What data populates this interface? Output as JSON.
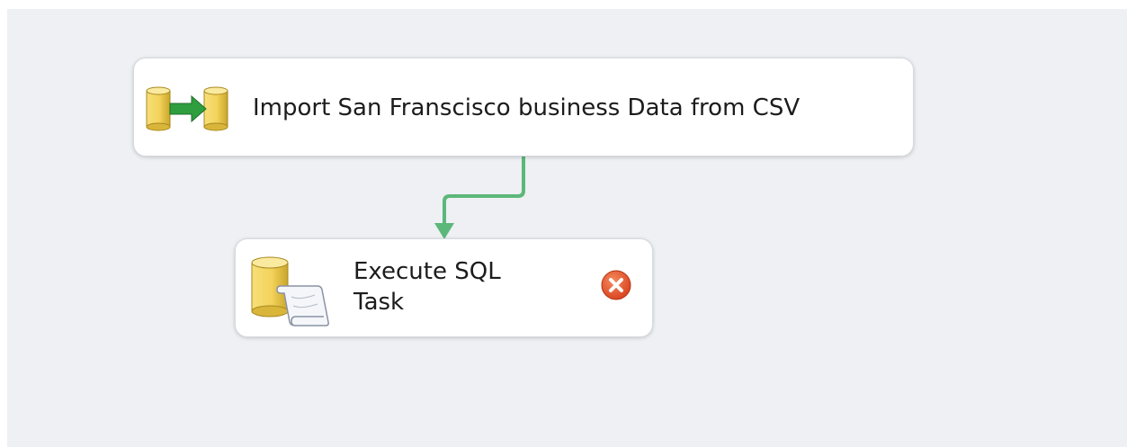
{
  "tasks": [
    {
      "label": "Import San Franscisco business Data from CSV",
      "icon": "data-flow-task-icon"
    },
    {
      "label_line1": "Execute SQL",
      "label_line2": "Task",
      "icon": "execute-sql-task-icon",
      "status_icon": "error-icon"
    }
  ],
  "connector": {
    "type": "success-precedence-constraint",
    "color": "#5cb87a"
  },
  "colors": {
    "canvas": "#eef0f3",
    "task_fill": "#ffffff",
    "error": "#e0441e"
  }
}
